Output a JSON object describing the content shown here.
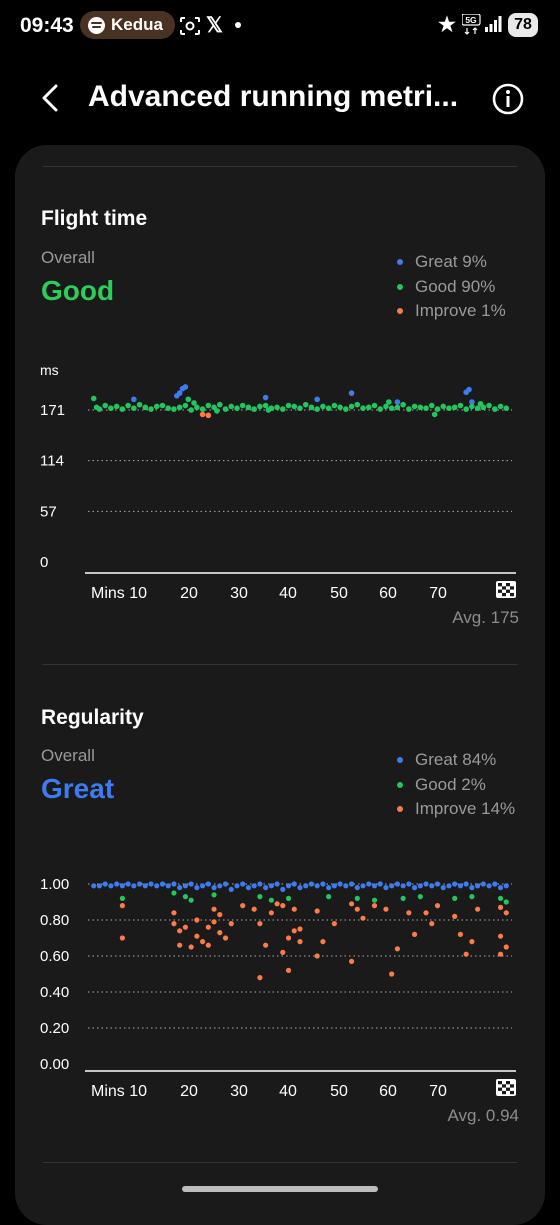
{
  "status_bar": {
    "time": "09:43",
    "spotify_label": "Kedua",
    "network": "5G",
    "battery": "78"
  },
  "header": {
    "title": "Advanced running metri..."
  },
  "sections": [
    {
      "title": "Flight time",
      "overall_label": "Overall",
      "rating": "Good",
      "rating_color": "#2ecc5b",
      "legend": [
        {
          "label": "Great 9%",
          "color": "#3d7cf0"
        },
        {
          "label": "Good 90%",
          "color": "#22c55e"
        },
        {
          "label": "Improve 1%",
          "color": "#ff7a45"
        }
      ],
      "avg": "Avg. 175"
    },
    {
      "title": "Regularity",
      "overall_label": "Overall",
      "rating": "Great",
      "rating_color": "#3d7cf0",
      "legend": [
        {
          "label": "Great 84%",
          "color": "#3d7cf0"
        },
        {
          "label": "Good 2%",
          "color": "#22c55e"
        },
        {
          "label": "Improve 14%",
          "color": "#ff7a45"
        }
      ],
      "avg": "Avg. 0.94"
    }
  ],
  "chart_data": [
    {
      "type": "scatter",
      "unit_label": "ms",
      "y_ticks": [
        "171",
        "114",
        "57",
        "0"
      ],
      "x_ticks": [
        "Mins 10",
        "20",
        "30",
        "40",
        "50",
        "60",
        "70"
      ],
      "xlim": [
        5,
        79
      ],
      "ylim": [
        0,
        171
      ],
      "grid": true,
      "finish_icon": "checkered-flag-icon",
      "series": [
        {
          "category": "Great",
          "color": "#3d7cf0",
          "points": [
            [
              13,
              183
            ],
            [
              21,
              190
            ],
            [
              21.5,
              195
            ],
            [
              22,
              197
            ],
            [
              20.5,
              187
            ],
            [
              36,
              185
            ],
            [
              45,
              183
            ],
            [
              51,
              190
            ],
            [
              59,
              180
            ],
            [
              71,
              191
            ],
            [
              71.5,
              194
            ],
            [
              72,
              180
            ]
          ]
        },
        {
          "category": "Good",
          "color": "#22c55e",
          "points": [
            [
              6,
              184
            ],
            [
              6.5,
              174
            ],
            [
              7,
              172
            ],
            [
              8,
              176
            ],
            [
              9,
              173
            ],
            [
              10,
              175
            ],
            [
              11,
              172
            ],
            [
              12,
              176
            ],
            [
              13,
              173
            ],
            [
              14,
              177
            ],
            [
              15,
              174
            ],
            [
              16,
              172
            ],
            [
              17,
              175
            ],
            [
              18,
              176
            ],
            [
              19,
              173
            ],
            [
              20,
              172
            ],
            [
              21,
              174
            ],
            [
              22,
              176
            ],
            [
              22.5,
              183
            ],
            [
              23,
              171
            ],
            [
              23.5,
              179
            ],
            [
              24,
              174
            ],
            [
              25,
              172
            ],
            [
              26,
              176
            ],
            [
              27,
              174
            ],
            [
              27.5,
              170
            ],
            [
              28,
              177
            ],
            [
              29,
              172
            ],
            [
              30,
              175
            ],
            [
              31,
              173
            ],
            [
              32,
              176
            ],
            [
              33,
              174
            ],
            [
              34,
              172
            ],
            [
              35,
              175
            ],
            [
              36,
              176
            ],
            [
              37,
              173
            ],
            [
              38,
              174
            ],
            [
              39,
              172
            ],
            [
              40,
              176
            ],
            [
              41,
              175
            ],
            [
              42,
              173
            ],
            [
              43,
              177
            ],
            [
              44,
              174
            ],
            [
              45,
              172
            ],
            [
              46,
              175
            ],
            [
              47,
              173
            ],
            [
              48,
              176
            ],
            [
              49,
              174
            ],
            [
              50,
              172
            ],
            [
              51,
              175
            ],
            [
              52,
              177
            ],
            [
              53,
              173
            ],
            [
              54,
              174
            ],
            [
              55,
              176
            ],
            [
              56,
              172
            ],
            [
              57,
              175
            ],
            [
              58,
              173
            ],
            [
              59,
              174
            ],
            [
              60,
              177
            ],
            [
              61,
              172
            ],
            [
              62,
              175
            ],
            [
              63,
              174
            ],
            [
              64,
              173
            ],
            [
              65,
              176
            ],
            [
              66,
              172
            ],
            [
              67,
              175
            ],
            [
              68,
              173
            ],
            [
              69,
              174
            ],
            [
              70,
              176
            ],
            [
              71,
              172
            ],
            [
              72,
              175
            ],
            [
              73,
              173
            ],
            [
              74,
              174
            ],
            [
              75,
              176
            ],
            [
              76,
              172
            ],
            [
              77,
              175
            ],
            [
              78,
              173
            ],
            [
              65.5,
              166
            ],
            [
              73.5,
              178
            ],
            [
              36.5,
              171
            ],
            [
              57.5,
              180
            ]
          ]
        },
        {
          "category": "Improve",
          "color": "#ff7a45",
          "points": [
            [
              25,
              166
            ],
            [
              26,
              165
            ]
          ]
        }
      ]
    },
    {
      "type": "scatter",
      "y_ticks": [
        "1.00",
        "0.80",
        "0.60",
        "0.40",
        "0.20",
        "0.00"
      ],
      "x_ticks": [
        "Mins 10",
        "20",
        "30",
        "40",
        "50",
        "60",
        "70"
      ],
      "xlim": [
        5,
        79
      ],
      "ylim": [
        0,
        1
      ],
      "grid": true,
      "finish_icon": "checkered-flag-icon",
      "series": [
        {
          "category": "Great",
          "color": "#3d7cf0",
          "points": [
            [
              6,
              0.99
            ],
            [
              7,
              0.99
            ],
            [
              8,
              1.0
            ],
            [
              9,
              0.99
            ],
            [
              10,
              1.0
            ],
            [
              11,
              0.99
            ],
            [
              12,
              1.0
            ],
            [
              13,
              0.99
            ],
            [
              14,
              1.0
            ],
            [
              15,
              0.99
            ],
            [
              16,
              1.0
            ],
            [
              17,
              0.99
            ],
            [
              18,
              1.0
            ],
            [
              19,
              0.99
            ],
            [
              20,
              1.0
            ],
            [
              21,
              0.98
            ],
            [
              22,
              0.99
            ],
            [
              23,
              1.0
            ],
            [
              24,
              0.98
            ],
            [
              25,
              0.99
            ],
            [
              26,
              1.0
            ],
            [
              27,
              0.98
            ],
            [
              28,
              0.99
            ],
            [
              29,
              1.0
            ],
            [
              30,
              0.97
            ],
            [
              31,
              0.99
            ],
            [
              32,
              1.0
            ],
            [
              33,
              0.98
            ],
            [
              34,
              0.99
            ],
            [
              35,
              1.0
            ],
            [
              36,
              0.98
            ],
            [
              37,
              0.99
            ],
            [
              38,
              1.0
            ],
            [
              39,
              0.97
            ],
            [
              40,
              0.99
            ],
            [
              41,
              1.0
            ],
            [
              42,
              0.98
            ],
            [
              43,
              0.99
            ],
            [
              44,
              1.0
            ],
            [
              45,
              0.99
            ],
            [
              46,
              1.0
            ],
            [
              47,
              0.98
            ],
            [
              48,
              0.99
            ],
            [
              49,
              1.0
            ],
            [
              50,
              0.99
            ],
            [
              51,
              1.0
            ],
            [
              52,
              0.98
            ],
            [
              53,
              0.99
            ],
            [
              54,
              1.0
            ],
            [
              55,
              0.99
            ],
            [
              56,
              1.0
            ],
            [
              57,
              0.98
            ],
            [
              58,
              0.99
            ],
            [
              59,
              1.0
            ],
            [
              60,
              0.99
            ],
            [
              61,
              1.0
            ],
            [
              62,
              0.98
            ],
            [
              63,
              0.99
            ],
            [
              64,
              1.0
            ],
            [
              65,
              0.99
            ],
            [
              66,
              1.0
            ],
            [
              67,
              0.98
            ],
            [
              68,
              0.99
            ],
            [
              69,
              1.0
            ],
            [
              70,
              0.99
            ],
            [
              71,
              1.0
            ],
            [
              72,
              0.98
            ],
            [
              73,
              0.99
            ],
            [
              74,
              1.0
            ],
            [
              75,
              0.99
            ],
            [
              76,
              1.0
            ],
            [
              77,
              0.98
            ],
            [
              78,
              0.99
            ]
          ]
        },
        {
          "category": "Good",
          "color": "#22c55e",
          "points": [
            [
              11,
              0.92
            ],
            [
              20,
              0.95
            ],
            [
              22,
              0.93
            ],
            [
              23,
              0.91
            ],
            [
              27,
              0.94
            ],
            [
              35,
              0.93
            ],
            [
              37,
              0.91
            ],
            [
              40,
              0.92
            ],
            [
              47,
              0.93
            ],
            [
              52,
              0.92
            ],
            [
              55,
              0.91
            ],
            [
              60,
              0.92
            ],
            [
              63,
              0.93
            ],
            [
              69,
              0.92
            ],
            [
              72,
              0.93
            ],
            [
              77,
              0.92
            ],
            [
              78,
              0.9
            ]
          ]
        },
        {
          "category": "Improve",
          "color": "#ff7a45",
          "points": [
            [
              11,
              0.88
            ],
            [
              11,
              0.7
            ],
            [
              20,
              0.84
            ],
            [
              20,
              0.78
            ],
            [
              21,
              0.74
            ],
            [
              21,
              0.66
            ],
            [
              22,
              0.76
            ],
            [
              23,
              0.65
            ],
            [
              24,
              0.8
            ],
            [
              24,
              0.71
            ],
            [
              25,
              0.68
            ],
            [
              26,
              0.76
            ],
            [
              26,
              0.66
            ],
            [
              27,
              0.86
            ],
            [
              27,
              0.79
            ],
            [
              28,
              0.73
            ],
            [
              28,
              0.83
            ],
            [
              29,
              0.7
            ],
            [
              30,
              0.78
            ],
            [
              32,
              0.88
            ],
            [
              34,
              0.86
            ],
            [
              35,
              0.78
            ],
            [
              35,
              0.48
            ],
            [
              36,
              0.66
            ],
            [
              37,
              0.84
            ],
            [
              38,
              0.89
            ],
            [
              39,
              0.88
            ],
            [
              39,
              0.62
            ],
            [
              40,
              0.7
            ],
            [
              40,
              0.52
            ],
            [
              41,
              0.86
            ],
            [
              41,
              0.74
            ],
            [
              42,
              0.75
            ],
            [
              42,
              0.68
            ],
            [
              45,
              0.85
            ],
            [
              45,
              0.6
            ],
            [
              46,
              0.68
            ],
            [
              48,
              0.78
            ],
            [
              51,
              0.89
            ],
            [
              52,
              0.86
            ],
            [
              51,
              0.57
            ],
            [
              53,
              0.81
            ],
            [
              55,
              0.88
            ],
            [
              57,
              0.86
            ],
            [
              58,
              0.5
            ],
            [
              59,
              0.64
            ],
            [
              61,
              0.84
            ],
            [
              62,
              0.72
            ],
            [
              64,
              0.84
            ],
            [
              65,
              0.78
            ],
            [
              66,
              0.88
            ],
            [
              69,
              0.82
            ],
            [
              70,
              0.72
            ],
            [
              71,
              0.61
            ],
            [
              72,
              0.68
            ],
            [
              73,
              0.86
            ],
            [
              77,
              0.87
            ],
            [
              77,
              0.71
            ],
            [
              78,
              0.84
            ],
            [
              78,
              0.65
            ],
            [
              77,
              0.61
            ]
          ]
        }
      ]
    }
  ]
}
